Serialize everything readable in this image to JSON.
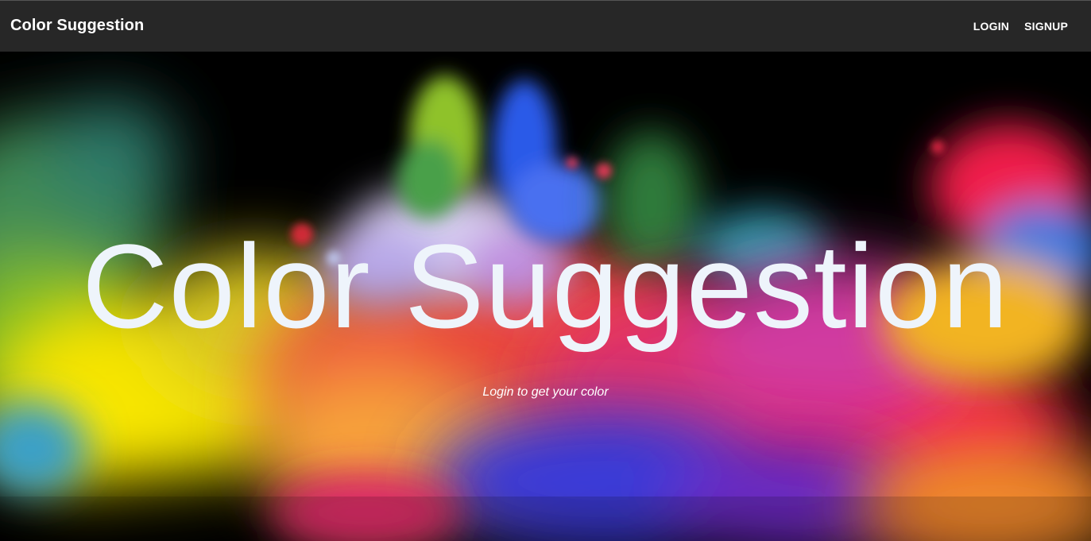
{
  "navbar": {
    "brand": "Color Suggestion",
    "links": [
      {
        "label": "LOGIN"
      },
      {
        "label": "SIGNUP"
      }
    ]
  },
  "hero": {
    "title": "Color Suggestion",
    "subtitle": "Login to get your color",
    "background_image": "colorful-powder-explosion"
  },
  "colors": {
    "navbar_background": "#272727",
    "hero_background": "#000000",
    "title_color": "#eef4fb"
  }
}
